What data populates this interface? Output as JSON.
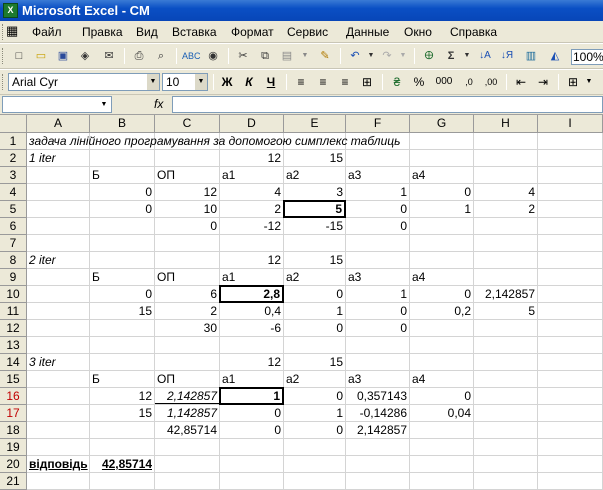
{
  "window": {
    "title": "Microsoft Excel - CM"
  },
  "menu": [
    "Файл",
    "Правка",
    "Вид",
    "Вставка",
    "Формат",
    "Сервис",
    "Данные",
    "Окно",
    "Справка"
  ],
  "toolbar": {
    "zoom": "100%"
  },
  "format_toolbar": {
    "font": "Arial Cyr",
    "size": "10",
    "bold": "Ж",
    "italic": "К",
    "underline": "Ч",
    "percent": "%",
    "thousands": "000"
  },
  "formula_bar": {
    "fx": "fx",
    "name_box": "",
    "formula": ""
  },
  "columns": [
    "A",
    "B",
    "C",
    "D",
    "E",
    "F",
    "G",
    "H",
    "I"
  ],
  "rows": [
    "1",
    "2",
    "3",
    "4",
    "5",
    "6",
    "7",
    "8",
    "9",
    "10",
    "11",
    "12",
    "13",
    "14",
    "15",
    "16",
    "17",
    "18",
    "19",
    "20",
    "21"
  ],
  "cells": {
    "A1": "задача лінійного програмування  за допомогою симплекс таблиць",
    "A2": "1 iter",
    "D2": "12",
    "E2": "15",
    "B3": "Б",
    "C3": "ОП",
    "D3": "a1",
    "E3": "a2",
    "F3": "a3",
    "G3": "a4",
    "B4": "0",
    "C4": "12",
    "D4": "4",
    "E4": "3",
    "F4": "1",
    "G4": "0",
    "H4": "4",
    "B5": "0",
    "C5": "10",
    "D5": "2",
    "E5": "5",
    "F5": "0",
    "G5": "1",
    "H5": "2",
    "C6": "0",
    "D6": "-12",
    "E6": "-15",
    "F6": "0",
    "A8": "2 iter",
    "D8": "12",
    "E8": "15",
    "B9": "Б",
    "C9": "ОП",
    "D9": "a1",
    "E9": "a2",
    "F9": "a3",
    "G9": "a4",
    "B10": "0",
    "C10": "6",
    "D10": "2,8",
    "E10": "0",
    "F10": "1",
    "G10": "0",
    "H10": "2,142857",
    "B11": "15",
    "C11": "2",
    "D11": "0,4",
    "E11": "1",
    "F11": "0",
    "G11": "0,2",
    "H11": "5",
    "C12": "30",
    "D12": "-6",
    "E12": "0",
    "F12": "0",
    "A14": "3 iter",
    "D14": "12",
    "E14": "15",
    "B15": "Б",
    "C15": "ОП",
    "D15": "a1",
    "E15": "a2",
    "F15": "a3",
    "G15": "a4",
    "B16": "12",
    "C16": "2,142857",
    "D16": "1",
    "E16": "0",
    "F16": "0,357143",
    "G16": "0",
    "B17": "15",
    "C17": "1,142857",
    "D17": "0",
    "E17": "1",
    "F17": "-0,14286",
    "G17": "0,04",
    "C18": "42,85714",
    "D18": "0",
    "E18": "0",
    "F18": "2,142857",
    "A20": "відповідь",
    "B20": "42,85714"
  }
}
